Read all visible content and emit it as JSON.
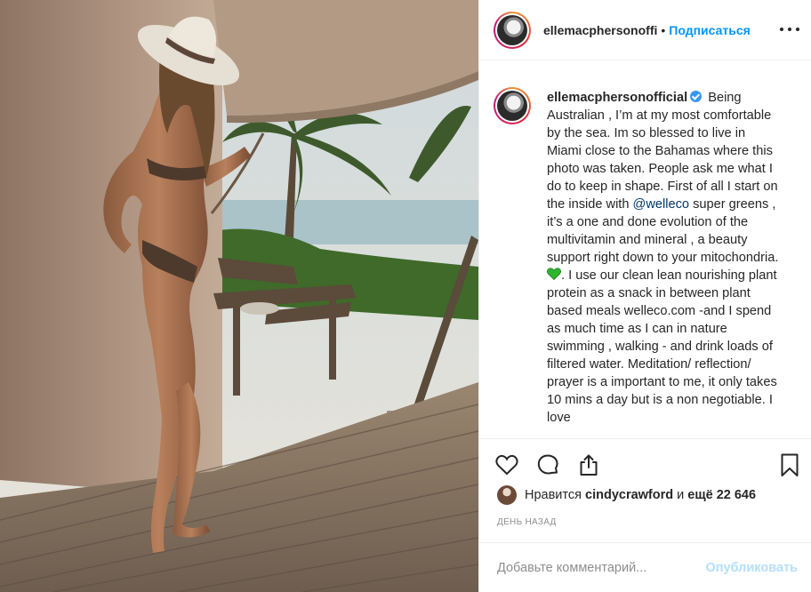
{
  "post": {
    "image_alt": "",
    "colors": {
      "accent": "#0095f6",
      "verified": "#3897f0",
      "muted": "#8e8e8e",
      "link": "#00376b",
      "post_disabled": "#b2dffc"
    }
  },
  "header": {
    "username": "ellemacphersonoffi",
    "separator": "•",
    "follow_label": "Подписаться",
    "more_icon": "more-horizontal-icon"
  },
  "caption": {
    "username": "ellemacphersonofficial",
    "verified_icon": "verified-badge-icon",
    "text_1": "Being Australian , I’m at my most comfortable by the sea. Im so blessed to live in Miami close to the Bahamas where this photo was taken. People ask me what I do to keep in shape. First of all I start on the inside with",
    "mention": "@welleco",
    "text_2": "super greens , it’s a one and done evolution of the multivitamin and mineral , a beauty support right down to your mitochondria.",
    "emoji": "green-heart-icon",
    "text_3": ". I use our clean lean nourishing plant protein as a snack in between plant based meals welleco.com -and I spend as much time as I can in nature swimming , walking - and drink loads of filtered water. Meditation/ reflection/ prayer is a important to me, it only takes 10 mins a day but is a non negotiable. I love"
  },
  "actions": {
    "like_icon": "heart-icon",
    "comment_icon": "comment-icon",
    "share_icon": "share-icon",
    "save_icon": "bookmark-icon"
  },
  "likes": {
    "prefix": "Нравится",
    "user": "cindycrawford",
    "conj": "и",
    "count": "ещё 22 646"
  },
  "timestamp": "день назад",
  "comment": {
    "placeholder": "Добавьте комментарий...",
    "post_label": "Опубликовать"
  }
}
